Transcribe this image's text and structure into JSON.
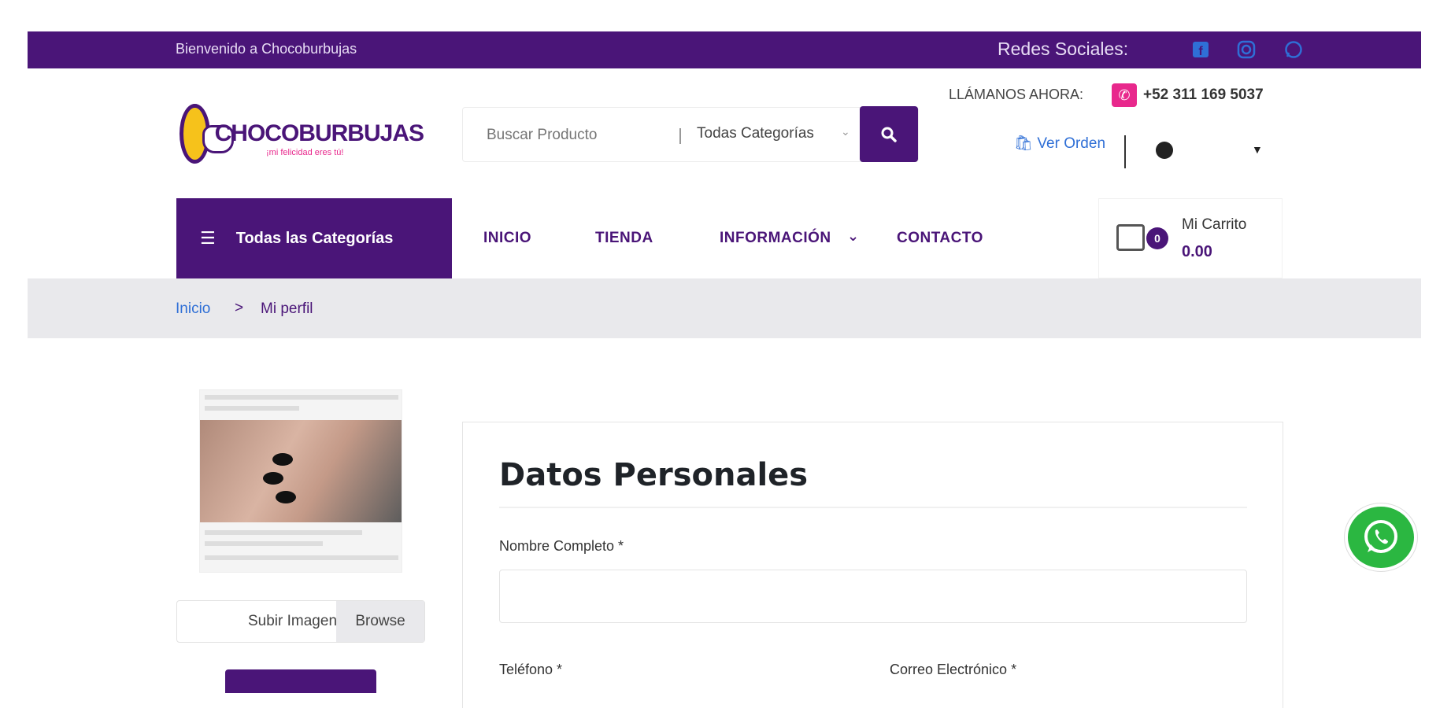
{
  "topbar": {
    "welcome": "Bienvenido a Chocoburbujas",
    "social_label": "Redes Sociales:",
    "social_icons": [
      "facebook-icon",
      "instagram-icon",
      "whatsapp-icon"
    ]
  },
  "header": {
    "logo_text": "CHOCOBURBUJAS",
    "logo_tagline": "¡mi felicidad eres tú!",
    "search": {
      "placeholder": "Buscar Producto",
      "category": "Todas Categorías"
    },
    "call_label": "LLÁMANOS AHORA:",
    "phone": "+52 311 169 5037",
    "ver_orden": "Ver Orden"
  },
  "nav": {
    "all_categories": "Todas las Categorías",
    "items": [
      "INICIO",
      "TIENDA",
      "INFORMACIÓN",
      "CONTACTO"
    ]
  },
  "cart": {
    "label": "Mi Carrito",
    "count": "0",
    "total": "0.00"
  },
  "breadcrumb": {
    "home": "Inicio",
    "separator": ">",
    "current": "Mi perfil"
  },
  "profile": {
    "upload_placeholder": "Subir Imagen",
    "browse_label": "Browse"
  },
  "form": {
    "title": "Datos Personales",
    "full_name_label": "Nombre Completo *",
    "phone_label": "Teléfono *",
    "email_label": "Correo Electrónico *"
  },
  "colors": {
    "brand": "#4a1578",
    "accent": "#e8288c",
    "link": "#2f6fd6",
    "whatsapp": "#2bb741"
  }
}
